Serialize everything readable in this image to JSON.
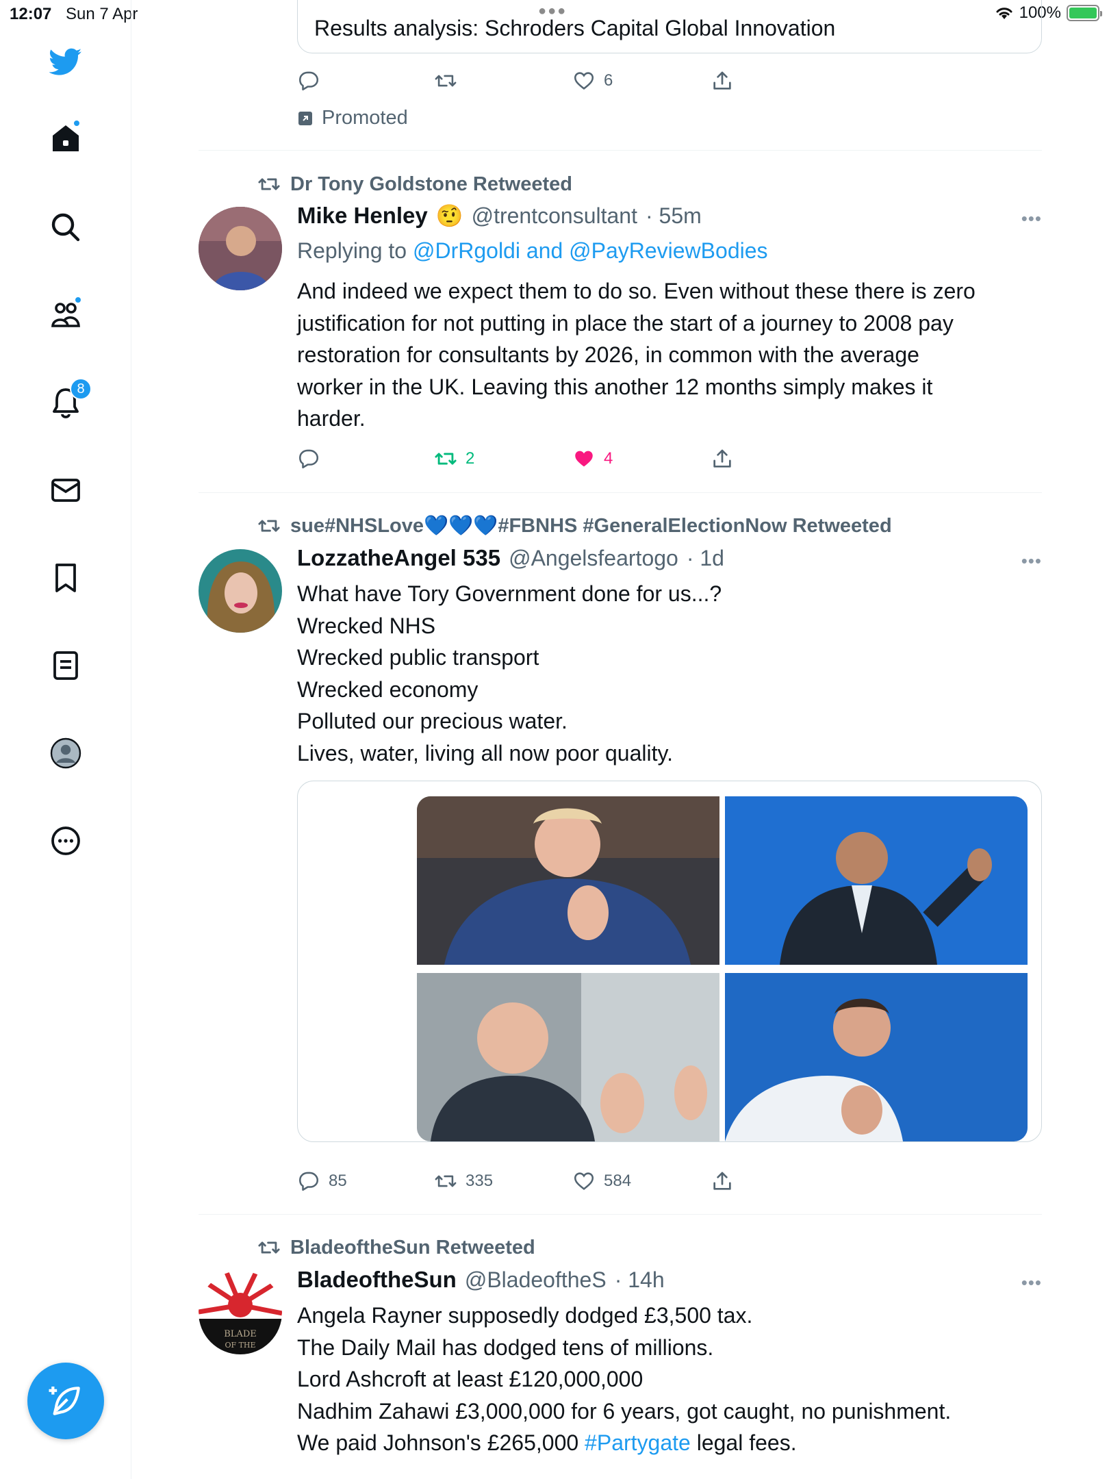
{
  "status_bar": {
    "time": "12:07",
    "date": "Sun 7 Apr",
    "battery": "100%"
  },
  "sidebar": {
    "items": [
      {
        "icon": "twitter-logo-icon"
      },
      {
        "icon": "home-icon",
        "has_dot": true
      },
      {
        "icon": "search-icon"
      },
      {
        "icon": "communities-icon",
        "has_dot": true
      },
      {
        "icon": "notifications-icon",
        "badge": "8"
      },
      {
        "icon": "messages-icon"
      },
      {
        "icon": "bookmarks-icon"
      },
      {
        "icon": "lists-icon"
      },
      {
        "icon": "profile-icon"
      },
      {
        "icon": "more-icon"
      }
    ],
    "compose_icon": "compose-feather-icon",
    "accent": "#1d9bf0"
  },
  "promo": {
    "card_title": "Results analysis: Schroders Capital Global Innovation",
    "likes": "6",
    "promoted_label": "Promoted"
  },
  "tweets": [
    {
      "retweeted_by": "Dr Tony Goldstone Retweeted",
      "name": "Mike Henley",
      "emoji": "🤨",
      "handle": "@trentconsultant",
      "time": "· 55m",
      "replying_prefix": "Replying to",
      "replying_to": "@DrRgoldi and @PayReviewBodies",
      "lines": [
        "And indeed we expect them to do so. Even without these there is zero",
        "justification for not putting in place the start of a journey to 2008 pay",
        "restoration for consultants by 2026, in common with the average",
        "worker in the UK. Leaving this another 12 months simply makes it",
        "harder."
      ],
      "retweets": "2",
      "likes": "4"
    },
    {
      "retweeted_by": "sue#NHSLove💙💙💙#FBNHS #GeneralElectionNow Retweeted",
      "name": "LozzatheAngel 535",
      "handle": "@Angelsfeartogo",
      "time": "· 1d",
      "lines": [
        "What have Tory Government done for us...?",
        "Wrecked NHS",
        "Wrecked public transport",
        "Wrecked economy",
        "Polluted our precious water.",
        "Lives, water, living all now poor quality."
      ],
      "replies": "85",
      "retweets": "335",
      "likes": "584"
    },
    {
      "retweeted_by": "BladeoftheSun Retweeted",
      "name": "BladeoftheSun",
      "handle": "@BladeoftheS",
      "time": "· 14h",
      "lines": [
        "Angela Rayner supposedly dodged £3,500 tax.",
        "The Daily Mail has dodged tens of millions.",
        "Lord Ashcroft at least £120,000,000",
        "Nadhim Zahawi £3,000,000 for 6 years, got caught, no punishment."
      ],
      "last_line_prefix": "We paid Johnson's £265,000 ",
      "last_line_hashtag": "#Partygate",
      "last_line_suffix": " legal fees.",
      "avatar_text": "BLADE OF THE"
    }
  ]
}
